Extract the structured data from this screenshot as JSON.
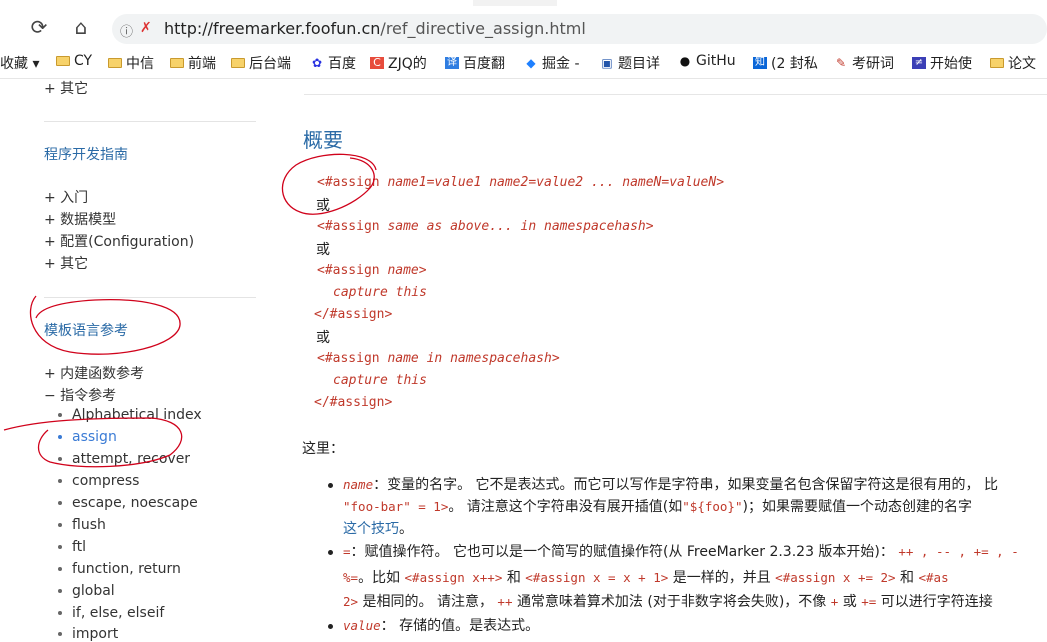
{
  "browser": {
    "url_host": "http://freemarker.foofun.cn",
    "url_path": "/ref_directive_assign.html",
    "reload_glyph": "⟳",
    "home_glyph": "⌂",
    "lock_glyph": "ⓘ",
    "shield_glyph": "✗"
  },
  "bookmarks": [
    {
      "label": "收藏 ▾",
      "icon": "none"
    },
    {
      "label": "CY",
      "icon": "folder"
    },
    {
      "label": "中信",
      "icon": "folder"
    },
    {
      "label": "前端",
      "icon": "folder"
    },
    {
      "label": "后台端",
      "icon": "folder"
    },
    {
      "label": "百度",
      "icon": "baidu-icon"
    },
    {
      "label": "ZJQ的",
      "icon": "c-icon"
    },
    {
      "label": "百度翻",
      "icon": "translate-icon"
    },
    {
      "label": "掘金 -",
      "icon": "juejin-icon"
    },
    {
      "label": "题目详",
      "icon": "question-icon"
    },
    {
      "label": "GitHu",
      "icon": "github-icon"
    },
    {
      "label": "(2 封私",
      "icon": "zhihu-icon"
    },
    {
      "label": "考研词",
      "icon": "word-icon"
    },
    {
      "label": "开始使",
      "icon": "start-icon"
    },
    {
      "label": "论文",
      "icon": "folder"
    }
  ],
  "sidebar": {
    "top_other": "+ 其它",
    "section1_title": "程序开发指南",
    "section1_items": [
      "+ 入门",
      "+ 数据模型",
      "+ 配置(Configuration)",
      "+ 其它"
    ],
    "section2_title": "模板语言参考",
    "section2_items": [
      "+ 内建函数参考",
      "− 指令参考"
    ],
    "directives": [
      "Alphabetical index",
      "assign",
      "attempt, recover",
      "compress",
      "escape, noescape",
      "flush",
      "ftl",
      "function, return",
      "global",
      "if, else, elseif",
      "import"
    ],
    "active_directive": "assign"
  },
  "main": {
    "title": "概要",
    "syn1_tag": "<#assign ",
    "syn1_args": "name1=value1 name2=value2 ... nameN=valueN",
    "syn1_end": ">",
    "or": "或",
    "syn2_tag": "<#assign ",
    "syn2_args": "same as above... in namespacehash",
    "syn2_end": ">",
    "syn3_open_tag": "<#assign ",
    "syn3_open_arg": "name",
    "syn3_open_end": ">",
    "syn3_body": "capture this",
    "syn3_close": "</#assign>",
    "syn4_open_tag": "<#assign ",
    "syn4_open_arg": "name in namespacehash",
    "syn4_open_end": ">",
    "syn4_body": "capture this",
    "syn4_close": "</#assign>",
    "where": "这里：",
    "b1_code": "name",
    "b1_text": "：变量的名字。 它不是表达式。而它可以写作是字符串，如果变量名包含保留字符这是很有用的， 比",
    "b1_line2_code": "\"foo-bar\" = 1>",
    "b1_line2_text": "。 请注意这个字符串没有展开插值(如",
    "b1_line2_code2": "\"${foo}\"",
    "b1_line2_text2": ")；如果需要赋值一个动态创建的名字",
    "b1_line3_link": "这个技巧",
    "b1_line3_end": "。",
    "b2_code": "=",
    "b2_text": "：赋值操作符。 它也可以是一个简写的赋值操作符(从 FreeMarker 2.3.23 版本开始)：",
    "b2_ops": "++ , -- , += , -",
    "b2_line2_a": "%=",
    "b2_line2_b": "。比如",
    "b2_line2_c": "<#assign x++>",
    "b2_line2_d": "和",
    "b2_line2_e": "<#assign x = x + 1>",
    "b2_line2_f": "是一样的，并且",
    "b2_line2_g": "<#assign x += 2>",
    "b2_line2_h": "和",
    "b2_line2_i": "<#as",
    "b2_line3_a": "2>",
    "b2_line3_b": "是相同的。 请注意，",
    "b2_line3_c": "++",
    "b2_line3_d": "通常意味着算术加法 (对于非数字将会失败)，不像",
    "b2_line3_e": "+",
    "b2_line3_f": "或",
    "b2_line3_g": "+=",
    "b2_line3_h": "可以进行字符连接",
    "b3_code": "value",
    "b3_text": "： 存储的值。是表达式。"
  }
}
